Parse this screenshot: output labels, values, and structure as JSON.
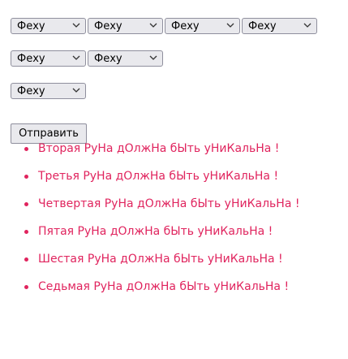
{
  "rune_selects": {
    "rows": [
      [
        "Феху",
        "Феху",
        "Феху",
        "Феху"
      ],
      [
        "Феху",
        "Феху"
      ],
      [
        "Феху"
      ]
    ]
  },
  "form": {
    "submit_label": "Отправить"
  },
  "errors": {
    "messages": [
      "Вторая РуНа дОлжНа бЫть уНиКальНа !",
      "Третья РуНа дОлжНа бЫть уНиКальНа !",
      "Четвертая РуНа дОлжНа бЫть уНиКальНа !",
      "Пятая РуНа дОлжНа бЫть уНиКальНа !",
      "Шестая РуНа дОлжНа бЫть уНиКальНа !",
      "Седьмая РуНа дОлжНа бЫть уНиКальНа !"
    ]
  },
  "colors": {
    "error_text": "#e0245e",
    "control_background": "#e9e9ed",
    "control_border": "#8f8f9d"
  }
}
